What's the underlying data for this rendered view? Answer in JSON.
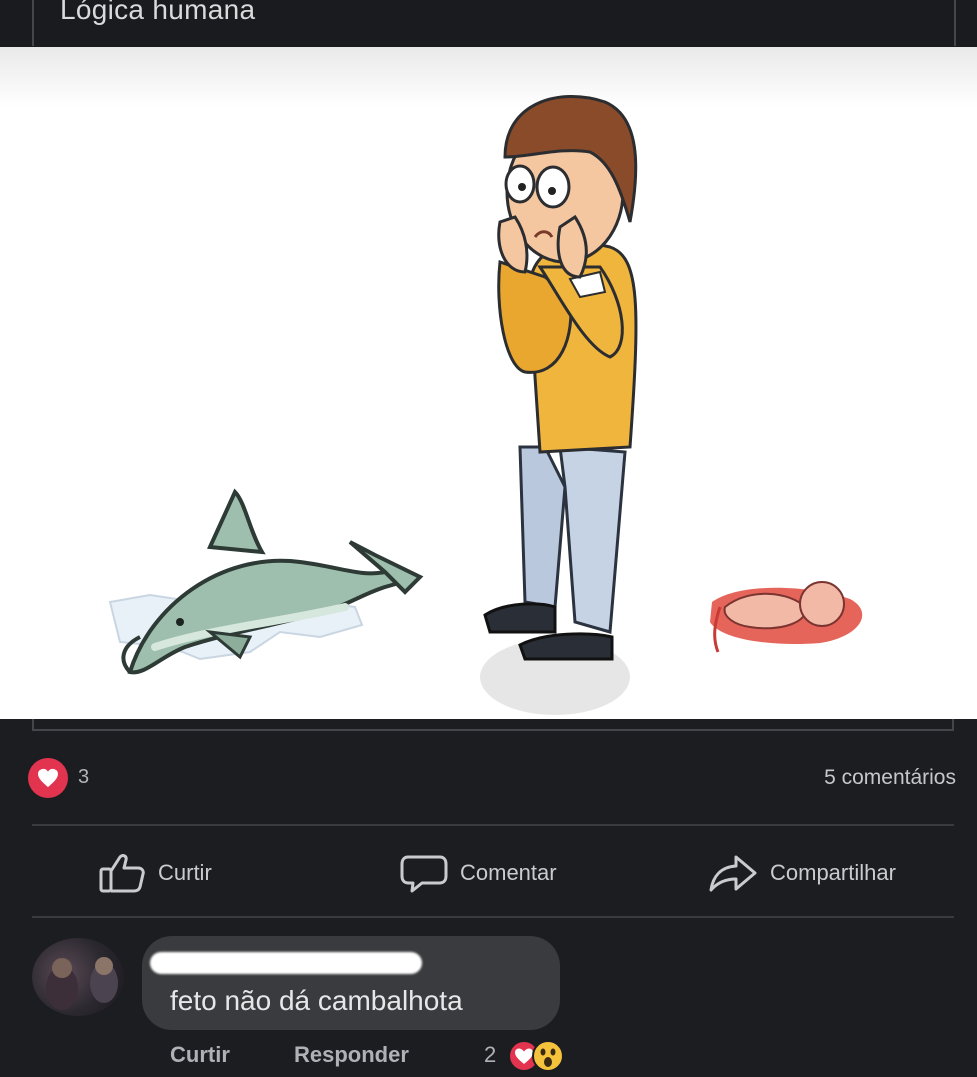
{
  "post": {
    "title": "Lógica humana",
    "reaction_count": "3",
    "comments_count": "5 comentários"
  },
  "actions": {
    "like": "Curtir",
    "comment": "Comentar",
    "share": "Compartilhar"
  },
  "comment": {
    "text": "feto não dá cambalhota",
    "like": "Curtir",
    "reply": "Responder",
    "reaction_count": "2"
  },
  "icons": [
    "heart-icon",
    "thumbs-up-icon",
    "speech-bubble-icon",
    "share-arrow-icon",
    "wow-emoji-icon"
  ],
  "colors": {
    "heart": "#e3344f",
    "wow": "#f5c33b",
    "background": "#1c1d20"
  }
}
